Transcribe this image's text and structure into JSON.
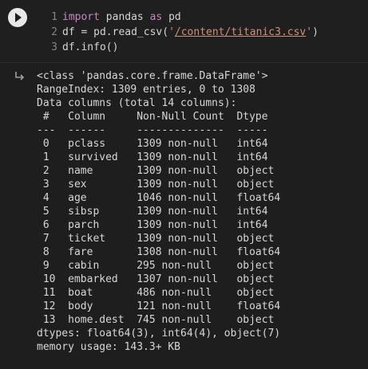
{
  "code_cell": {
    "line_numbers": [
      "1",
      "2",
      "3"
    ],
    "line1": {
      "kw1": "import",
      "mid": " pandas ",
      "kw2": "as",
      "end": " pd"
    },
    "line2": {
      "pre": "df = pd.read_csv(",
      "q1": "'",
      "path": "/content/titanic3.csv",
      "q2": "'",
      "post": ")"
    },
    "line3": {
      "text": "df.info()"
    }
  },
  "output": {
    "lines": [
      "<class 'pandas.core.frame.DataFrame'>",
      "RangeIndex: 1309 entries, 0 to 1308",
      "Data columns (total 14 columns):",
      " #   Column     Non-Null Count  Dtype  ",
      "---  ------     --------------  -----  ",
      " 0   pclass     1309 non-null   int64  ",
      " 1   survived   1309 non-null   int64  ",
      " 2   name       1309 non-null   object ",
      " 3   sex        1309 non-null   object ",
      " 4   age        1046 non-null   float64",
      " 5   sibsp      1309 non-null   int64  ",
      " 6   parch      1309 non-null   int64  ",
      " 7   ticket     1309 non-null   object ",
      " 8   fare       1308 non-null   float64",
      " 9   cabin      295 non-null    object ",
      " 10  embarked   1307 non-null   object ",
      " 11  boat       486 non-null    object ",
      " 12  body       121 non-null    float64",
      " 13  home.dest  745 non-null    object ",
      "dtypes: float64(3), int64(4), object(7)",
      "memory usage: 143.3+ KB"
    ]
  },
  "colors": {
    "background": "#1e1e1e",
    "keyword": "#c586c0",
    "string": "#ce9178",
    "text": "#d4d4d4"
  },
  "icons": {
    "run": "play-icon",
    "output": "output-redirect-icon"
  }
}
